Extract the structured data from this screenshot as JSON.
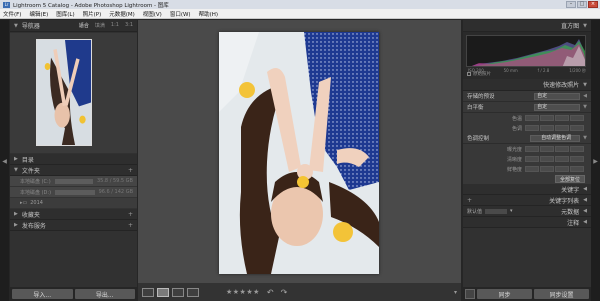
{
  "title_bar": {
    "logo": "Lr",
    "title": "Lightroom 5 Catalog - Adobe Photoshop Lightroom - 图库",
    "min": "–",
    "max": "□",
    "close": "×"
  },
  "menu": [
    "文件(F)",
    "编辑(E)",
    "图库(L)",
    "照片(P)",
    "元数据(M)",
    "视图(V)",
    "窗口(W)",
    "帮助(H)"
  ],
  "left_panel": {
    "navigator": {
      "title": "导航器",
      "options": [
        "适合",
        "填满",
        "1:1",
        "3:1"
      ]
    },
    "catalog": "目录",
    "folders": "文件夹",
    "folder_rows": [
      {
        "name": "本地磁盘 (C:)",
        "count": "35.8 / 59.5 GB"
      },
      {
        "name": "本地磁盘 (D:)",
        "count": "96.6 / 142 GB"
      }
    ],
    "subfolder": "2014",
    "collections": "收藏夹",
    "publish": "发布服务",
    "import_btn": "导入...",
    "export_btn": "导出..."
  },
  "toolbar": {
    "stars": "★★★★★"
  },
  "right_panel": {
    "histogram": {
      "title": "直方图",
      "labels": [
        "ISO 200",
        "50 mm",
        "f / 2.8",
        "1/200 秒"
      ],
      "original": "原始照片"
    },
    "quick_develop": {
      "title": "快速修改照片",
      "saved_preset": {
        "label": "存储的预设",
        "value": "自定"
      },
      "white_balance": {
        "label": "白平衡",
        "value": "自定"
      },
      "temp": "色温",
      "tint": "色调",
      "tone_control": {
        "label": "色调控制",
        "value": "自动调整色调"
      },
      "exposure": "曝光度",
      "clarity": "清晰度",
      "vibrance": "鲜艳度",
      "reset": "全部复位"
    },
    "keywording": "关键字",
    "keyword_list": "关键字列表",
    "metadata": {
      "preset": "默认值",
      "title": "元数据"
    },
    "comments": "注释",
    "sync": "同步",
    "sync_settings": "同步设置"
  }
}
